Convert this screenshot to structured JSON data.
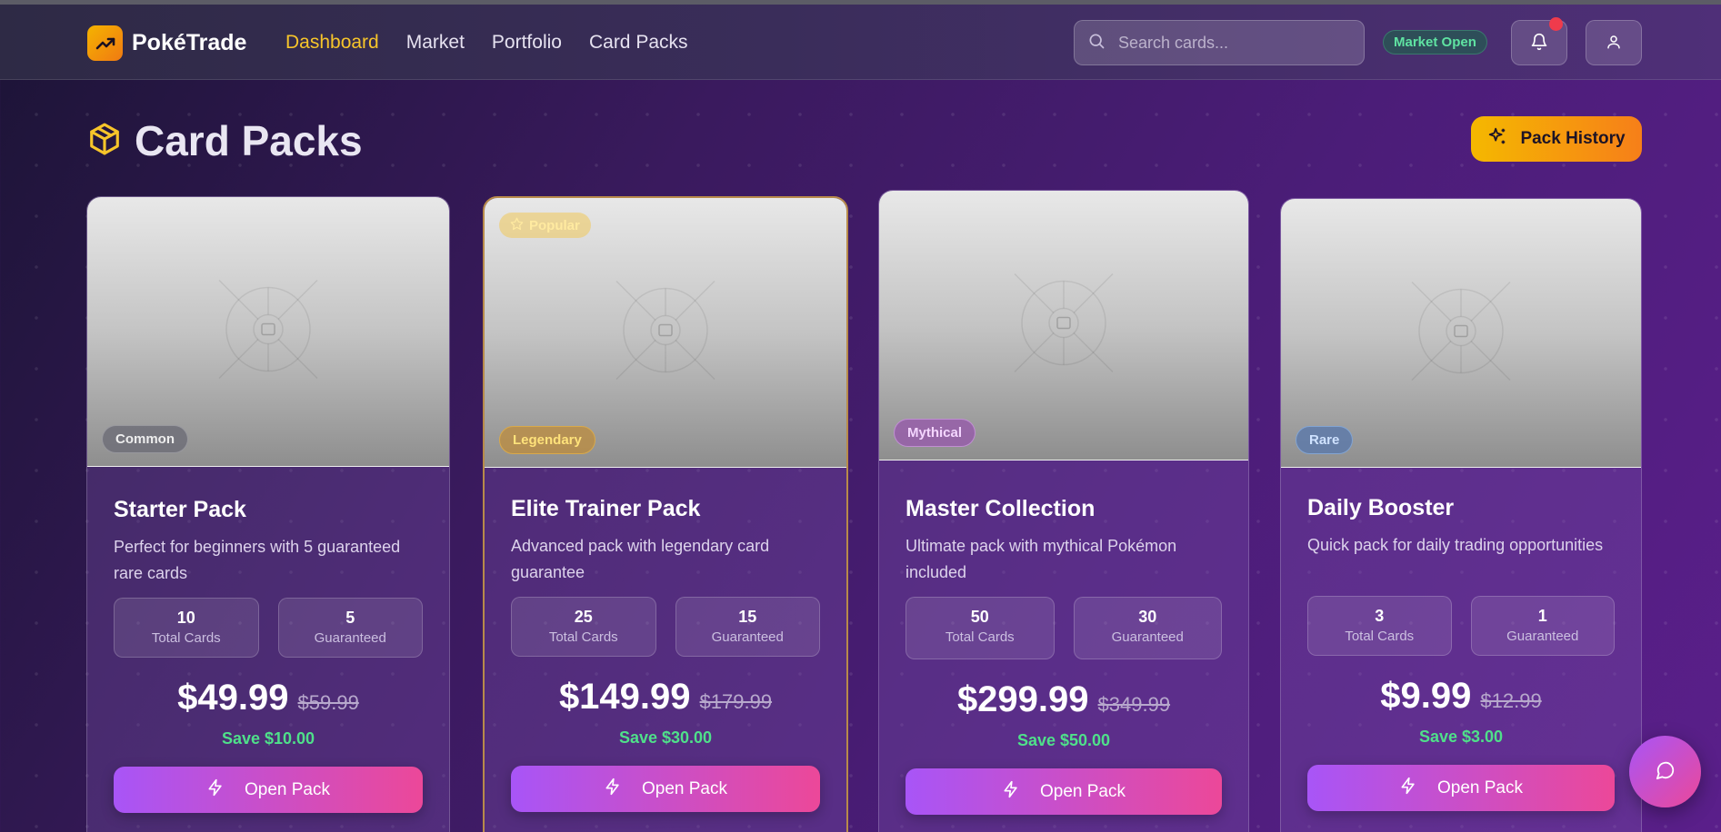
{
  "app": {
    "name": "PokéTrade"
  },
  "nav": {
    "items": [
      {
        "label": "Dashboard",
        "active": true
      },
      {
        "label": "Market",
        "active": false
      },
      {
        "label": "Portfolio",
        "active": false
      },
      {
        "label": "Card Packs",
        "active": false
      }
    ]
  },
  "search": {
    "placeholder": "Search cards..."
  },
  "status": {
    "market": "Market Open"
  },
  "page": {
    "title": "Card Packs",
    "history_button": "Pack History"
  },
  "packs": [
    {
      "rarity": "Common",
      "name": "Starter Pack",
      "description": "Perfect for beginners with 5 guaranteed rare cards",
      "total_cards": "10",
      "total_label": "Total Cards",
      "guaranteed": "5",
      "guaranteed_label": "Guaranteed",
      "price": "$49.99",
      "old_price": "$59.99",
      "savings": "Save $10.00",
      "button": "Open Pack"
    },
    {
      "badge": "Popular",
      "rarity": "Legendary",
      "name": "Elite Trainer Pack",
      "description": "Advanced pack with legendary card guarantee",
      "total_cards": "25",
      "total_label": "Total Cards",
      "guaranteed": "15",
      "guaranteed_label": "Guaranteed",
      "price": "$149.99",
      "old_price": "$179.99",
      "savings": "Save $30.00",
      "button": "Open Pack"
    },
    {
      "rarity": "Mythical",
      "name": "Master Collection",
      "description": "Ultimate pack with mythical Pokémon included",
      "total_cards": "50",
      "total_label": "Total Cards",
      "guaranteed": "30",
      "guaranteed_label": "Guaranteed",
      "price": "$299.99",
      "old_price": "$349.99",
      "savings": "Save $50.00",
      "button": "Open Pack"
    },
    {
      "rarity": "Rare",
      "name": "Daily Booster",
      "description": "Quick pack for daily trading opportunities",
      "total_cards": "3",
      "total_label": "Total Cards",
      "guaranteed": "1",
      "guaranteed_label": "Guaranteed",
      "price": "$9.99",
      "old_price": "$12.99",
      "savings": "Save $3.00",
      "button": "Open Pack"
    }
  ],
  "colors": {
    "accent_gold": "#f7c52a",
    "button_gradient_start": "#a855f7",
    "button_gradient_end": "#ec4899",
    "savings_green": "#4fe08a",
    "market_open_green": "#5fe3a2",
    "notification_red": "#ef3b4c"
  },
  "icons": {
    "logo": "trending-up-icon",
    "search": "search-icon",
    "notifications": "bell-icon",
    "profile": "user-icon",
    "title": "package-icon",
    "history": "sparkles-icon",
    "open_pack": "zap-icon",
    "popular": "star-icon",
    "pack_image": "image-placeholder-icon",
    "chat": "message-circle-icon"
  }
}
